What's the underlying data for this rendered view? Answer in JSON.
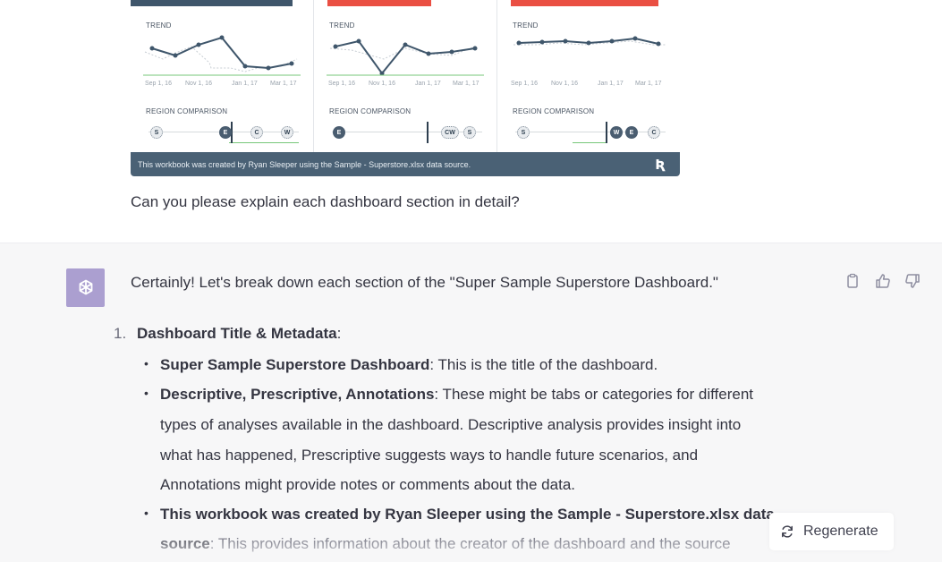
{
  "dashboard": {
    "colors": {
      "navy": "#3f566b",
      "red": "#ea4f43",
      "white": "#ffffff"
    },
    "panels": [
      {
        "trend_label": "TREND",
        "ticks": [
          "Sep 1, 16",
          "Nov 1, 16",
          "Jan 1, 17",
          "Mar 1, 17"
        ],
        "region_label": "REGION COMPARISON",
        "dots": [
          "S",
          "E",
          "C",
          "W"
        ]
      },
      {
        "trend_label": "TREND",
        "ticks": [
          "Sep 1, 16",
          "Nov 1, 16",
          "Jan 1, 17",
          "Mar 1, 17"
        ],
        "region_label": "REGION COMPARISON",
        "dots": [
          "E",
          "CW",
          "S"
        ]
      },
      {
        "trend_label": "TREND",
        "ticks": [
          "Sep 1, 16",
          "Nov 1, 16",
          "Jan 1, 17",
          "Mar 1, 17"
        ],
        "region_label": "REGION COMPARISON",
        "dots": [
          "S",
          "W",
          "E",
          "C"
        ]
      }
    ],
    "footer_text": "This workbook was created by Ryan Sleeper using the Sample - Superstore.xlsx data source."
  },
  "user_message": "Can you please explain each dashboard section in detail?",
  "assistant": {
    "intro": "Certainly! Let's break down each section of the \"Super Sample Superstore Dashboard.\"",
    "item1": {
      "number": "1.",
      "title": "Dashboard Title & Metadata",
      "colon": ":"
    },
    "bullets": [
      {
        "bold": "Super Sample Superstore Dashboard",
        "rest": ": This is the title of the dashboard."
      },
      {
        "bold": "Descriptive, Prescriptive, Annotations",
        "rest": ": These might be tabs or categories for different"
      },
      {
        "rest": "types of analyses available in the dashboard. Descriptive analysis provides insight into"
      },
      {
        "rest": "what has happened, Prescriptive suggests ways to handle future scenarios, and"
      },
      {
        "rest": "Annotations might provide notes or comments about the data."
      },
      {
        "bold": "This workbook was created by Ryan Sleeper using the Sample - Superstore.xlsx data"
      },
      {
        "bold": "source",
        "rest": ": This provides information about the creator of the dashboard and the source"
      }
    ]
  },
  "actions": {
    "copy": "copy-icon",
    "thumbs_up": "thumbs-up-icon",
    "thumbs_down": "thumbs-down-icon"
  },
  "regenerate_label": "Regenerate"
}
